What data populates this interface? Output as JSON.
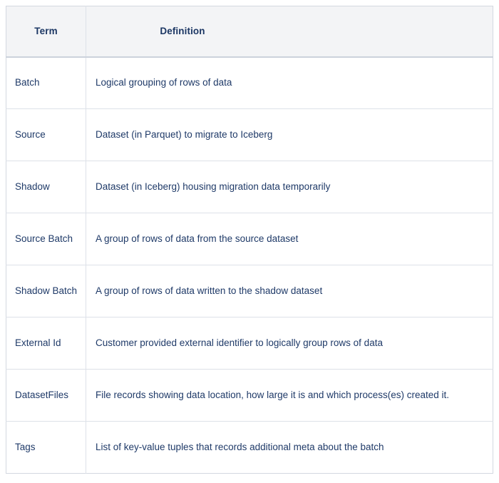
{
  "table": {
    "columns": [
      {
        "key": "term",
        "label": "Term"
      },
      {
        "key": "definition",
        "label": "Definition"
      }
    ],
    "rows": [
      {
        "term": "Batch",
        "definition": "Logical grouping of rows of data"
      },
      {
        "term": "Source",
        "definition": "Dataset (in Parquet) to migrate to Iceberg"
      },
      {
        "term": "Shadow",
        "definition": "Dataset (in Iceberg) housing migration data temporarily"
      },
      {
        "term": "Source Batch",
        "definition": "A group of rows of data from the source dataset"
      },
      {
        "term": "Shadow Batch",
        "definition": "A group of rows of data written to the shadow dataset"
      },
      {
        "term": "External Id",
        "definition": "Customer provided external identifier to logically group rows of data"
      },
      {
        "term": "DatasetFiles",
        "definition": "File records showing data location, how large it is and which process(es) created it."
      },
      {
        "term": "Tags",
        "definition": "List of key-value tuples that records additional meta about the batch"
      }
    ]
  },
  "colors": {
    "header_background": "#f3f4f6",
    "header_text": "#1c3764",
    "body_text": "#1f3a68",
    "border": "#dde1e8",
    "outer_border": "#d3d8e0"
  }
}
